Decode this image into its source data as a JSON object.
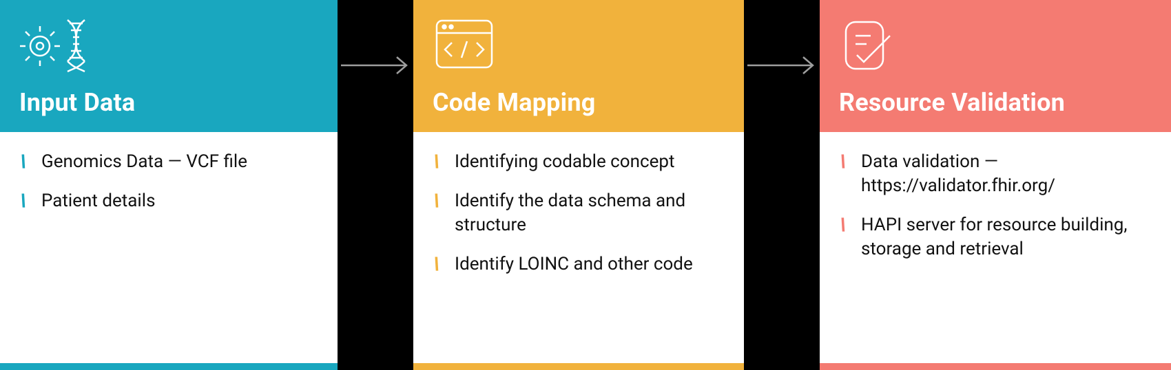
{
  "cards": [
    {
      "title": "Input Data",
      "items": [
        "Genomics Data — VCF file",
        "Patient details"
      ]
    },
    {
      "title": "Code Mapping",
      "items": [
        "Identifying codable concept",
        "Identify the data schema and structure",
        "Identify LOINC and other code"
      ]
    },
    {
      "title": "Resource Validation",
      "items": [
        "Data validation — https://validator.fhir.org/",
        "HAPI server for resource building, storage and retrieval"
      ]
    }
  ],
  "colors": {
    "card0": "#19a7bf",
    "card1": "#f1b23c",
    "card2": "#f47b72"
  }
}
